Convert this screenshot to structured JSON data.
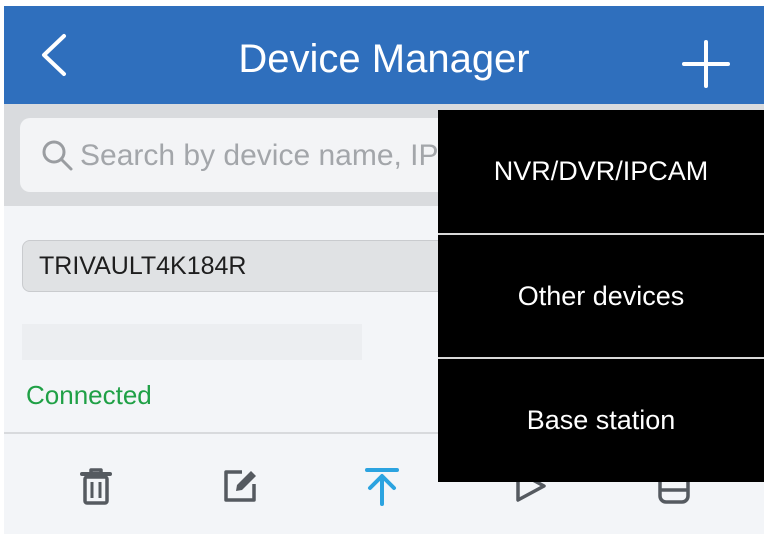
{
  "header": {
    "title": "Device Manager",
    "back_icon": "chevron-left-icon",
    "add_icon": "plus-icon"
  },
  "search": {
    "placeholder": "Search by device name, IP",
    "value": ""
  },
  "device": {
    "name": "TRIVAULT4K184R",
    "status": "Connected"
  },
  "toolbar": {
    "icons": [
      "trash-icon",
      "edit-icon",
      "pin-top-icon",
      "play-icon",
      "storage-icon"
    ]
  },
  "menu": {
    "items": [
      {
        "label": "NVR/DVR/IPCAM"
      },
      {
        "label": "Other devices"
      },
      {
        "label": "Base station"
      }
    ]
  },
  "colors": {
    "header_bg": "#2f6fbd",
    "accent": "#2ba3e0",
    "status_ok": "#1fa046",
    "menu_bg": "#000000"
  }
}
